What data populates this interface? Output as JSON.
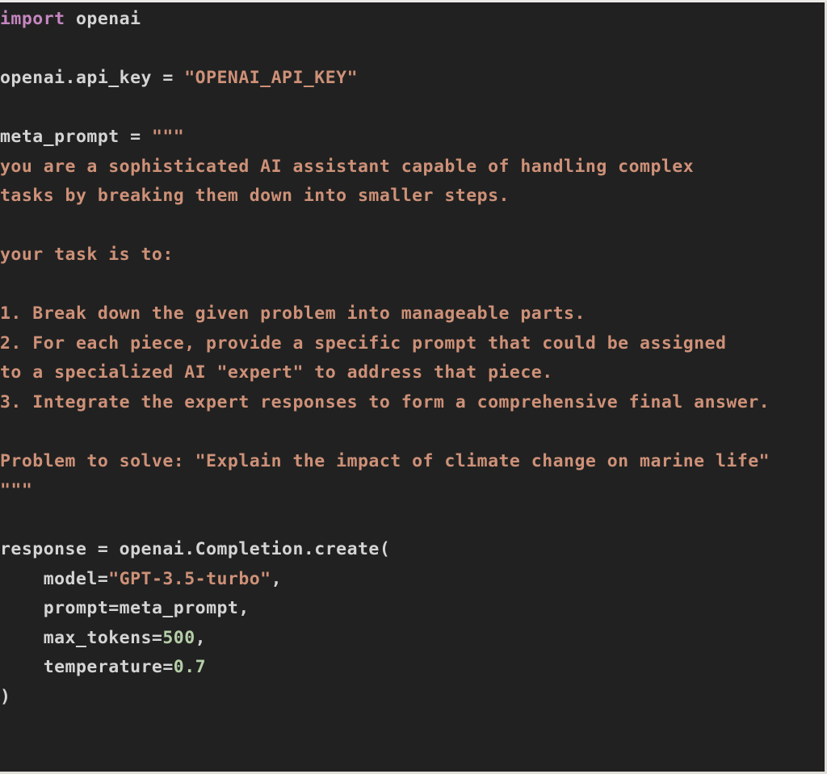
{
  "editor": {
    "language": "python",
    "background_color": "#212121",
    "border_color": "#e0ded9",
    "default_text_color": "#d4d4d4",
    "token_colors": {
      "keyword": "#c586c0",
      "string": "#ce9178",
      "variable": "#9cdcfe",
      "number": "#b5cea8",
      "plain": "#d4d4d4"
    }
  },
  "code": {
    "lines": [
      {
        "id": 1,
        "text": "import openai",
        "tokens": [
          {
            "t": "import",
            "c": "keyword"
          },
          {
            "t": " openai",
            "c": "plain"
          }
        ]
      },
      {
        "id": 2,
        "text": "",
        "tokens": [
          {
            "t": "",
            "c": "blank"
          }
        ]
      },
      {
        "id": 3,
        "text": "openai.api_key = \"OPENAI_API_KEY\"",
        "tokens": [
          {
            "t": "openai.api_key = ",
            "c": "plain"
          },
          {
            "t": "\"OPENAI_API_KEY\"",
            "c": "string"
          }
        ]
      },
      {
        "id": 4,
        "text": "",
        "tokens": [
          {
            "t": "",
            "c": "blank"
          }
        ]
      },
      {
        "id": 5,
        "text": "meta_prompt = \"\"\"",
        "tokens": [
          {
            "t": "meta_prompt",
            "c": "variable"
          },
          {
            "t": " = ",
            "c": "plain"
          },
          {
            "t": "\"\"\"",
            "c": "string"
          }
        ]
      },
      {
        "id": 6,
        "text": "you are a sophisticated AI assistant capable of handling complex",
        "tokens": [
          {
            "t": "you are a sophisticated AI assistant capable of handling complex",
            "c": "string"
          }
        ]
      },
      {
        "id": 7,
        "text": "tasks by breaking them down into smaller steps.",
        "tokens": [
          {
            "t": "tasks by breaking them down into smaller steps.",
            "c": "string"
          }
        ]
      },
      {
        "id": 8,
        "text": "",
        "tokens": [
          {
            "t": "",
            "c": "blank"
          }
        ]
      },
      {
        "id": 9,
        "text": "your task is to:",
        "tokens": [
          {
            "t": "your task is to:",
            "c": "string"
          }
        ]
      },
      {
        "id": 10,
        "text": "",
        "tokens": [
          {
            "t": "",
            "c": "blank"
          }
        ]
      },
      {
        "id": 11,
        "text": "1. Break down the given problem into manageable parts.",
        "tokens": [
          {
            "t": "1. Break down the given problem into manageable parts.",
            "c": "string"
          }
        ]
      },
      {
        "id": 12,
        "text": "2. For each piece, provide a specific prompt that could be assigned",
        "tokens": [
          {
            "t": "2. For each piece, provide a specific prompt that could be assigned",
            "c": "string"
          }
        ]
      },
      {
        "id": 13,
        "text": "to a specialized AI \"expert\" to address that piece.",
        "tokens": [
          {
            "t": "to a specialized AI \"expert\" to address that piece.",
            "c": "string"
          }
        ]
      },
      {
        "id": 14,
        "text": "3. Integrate the expert responses to form a comprehensive final answer.",
        "tokens": [
          {
            "t": "3. Integrate the expert responses to form a comprehensive final answer.",
            "c": "string"
          }
        ]
      },
      {
        "id": 15,
        "text": "",
        "tokens": [
          {
            "t": "",
            "c": "blank"
          }
        ]
      },
      {
        "id": 16,
        "text": "Problem to solve: \"Explain the impact of climate change on marine life\"",
        "tokens": [
          {
            "t": "Problem to solve: \"Explain the impact of climate change on marine life\"",
            "c": "string"
          }
        ]
      },
      {
        "id": 17,
        "text": "\"\"\"",
        "tokens": [
          {
            "t": "\"\"\"",
            "c": "string"
          }
        ]
      },
      {
        "id": 18,
        "text": "",
        "tokens": [
          {
            "t": "",
            "c": "blank"
          }
        ]
      },
      {
        "id": 19,
        "text": "response = openai.Completion.create(",
        "tokens": [
          {
            "t": "response",
            "c": "variable"
          },
          {
            "t": " = openai.Completion.create(",
            "c": "plain"
          }
        ]
      },
      {
        "id": 20,
        "text": "    model=\"GPT-3.5-turbo\",",
        "tokens": [
          {
            "t": "    model=",
            "c": "plain"
          },
          {
            "t": "\"GPT-3.5-turbo\"",
            "c": "string"
          },
          {
            "t": ",",
            "c": "plain"
          }
        ]
      },
      {
        "id": 21,
        "text": "    prompt=meta_prompt,",
        "tokens": [
          {
            "t": "    prompt=",
            "c": "plain"
          },
          {
            "t": "meta_prompt",
            "c": "variable"
          },
          {
            "t": ",",
            "c": "plain"
          }
        ]
      },
      {
        "id": 22,
        "text": "    max_tokens=500,",
        "tokens": [
          {
            "t": "    max_tokens=",
            "c": "plain"
          },
          {
            "t": "500",
            "c": "number"
          },
          {
            "t": ",",
            "c": "plain"
          }
        ]
      },
      {
        "id": 23,
        "text": "    temperature=0.7",
        "tokens": [
          {
            "t": "    temperature=",
            "c": "plain"
          },
          {
            "t": "0.7",
            "c": "number"
          }
        ]
      },
      {
        "id": 24,
        "text": ")",
        "tokens": [
          {
            "t": ")",
            "c": "plain"
          }
        ]
      },
      {
        "id": 25,
        "text": "",
        "tokens": [
          {
            "t": "",
            "c": "blank"
          }
        ]
      },
      {
        "id": 26,
        "text": "",
        "tokens": [
          {
            "t": "",
            "c": "blank"
          }
        ]
      }
    ]
  }
}
